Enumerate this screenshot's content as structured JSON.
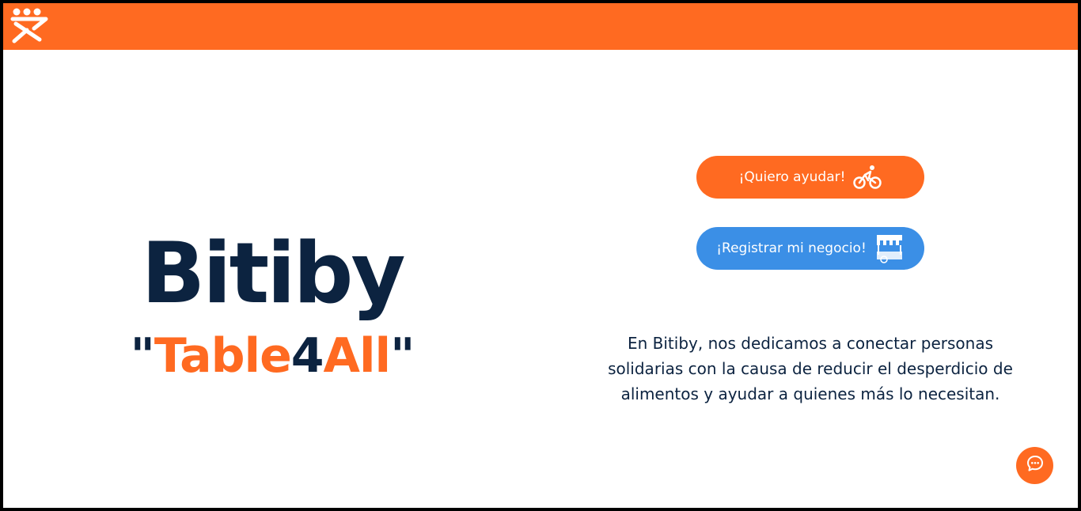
{
  "header": {
    "logo_icon": "bitiby-logo-icon",
    "background_color": "#ff6a21"
  },
  "hero": {
    "title": "Bitiby",
    "tagline": {
      "quote_open": "\"",
      "part1": "Table",
      "part2": "4",
      "part3": "All",
      "quote_close": "\""
    }
  },
  "actions": {
    "help_label": "¡Quiero ayudar!",
    "help_icon": "bicycle-icon",
    "help_color": "#ff6a21",
    "register_label": "¡Registrar mi negocio!",
    "register_icon": "market-stall-icon",
    "register_color": "#3b8fe6"
  },
  "description": "En Bitiby, nos dedicamos a conectar personas solidarias con la causa de reducir el desperdicio de alimentos y ayudar a quienes más lo necesitan.",
  "chat": {
    "icon": "chat-bubble-icon"
  },
  "colors": {
    "navy": "#0c2340",
    "orange": "#ff6a21",
    "blue": "#3b8fe6"
  }
}
